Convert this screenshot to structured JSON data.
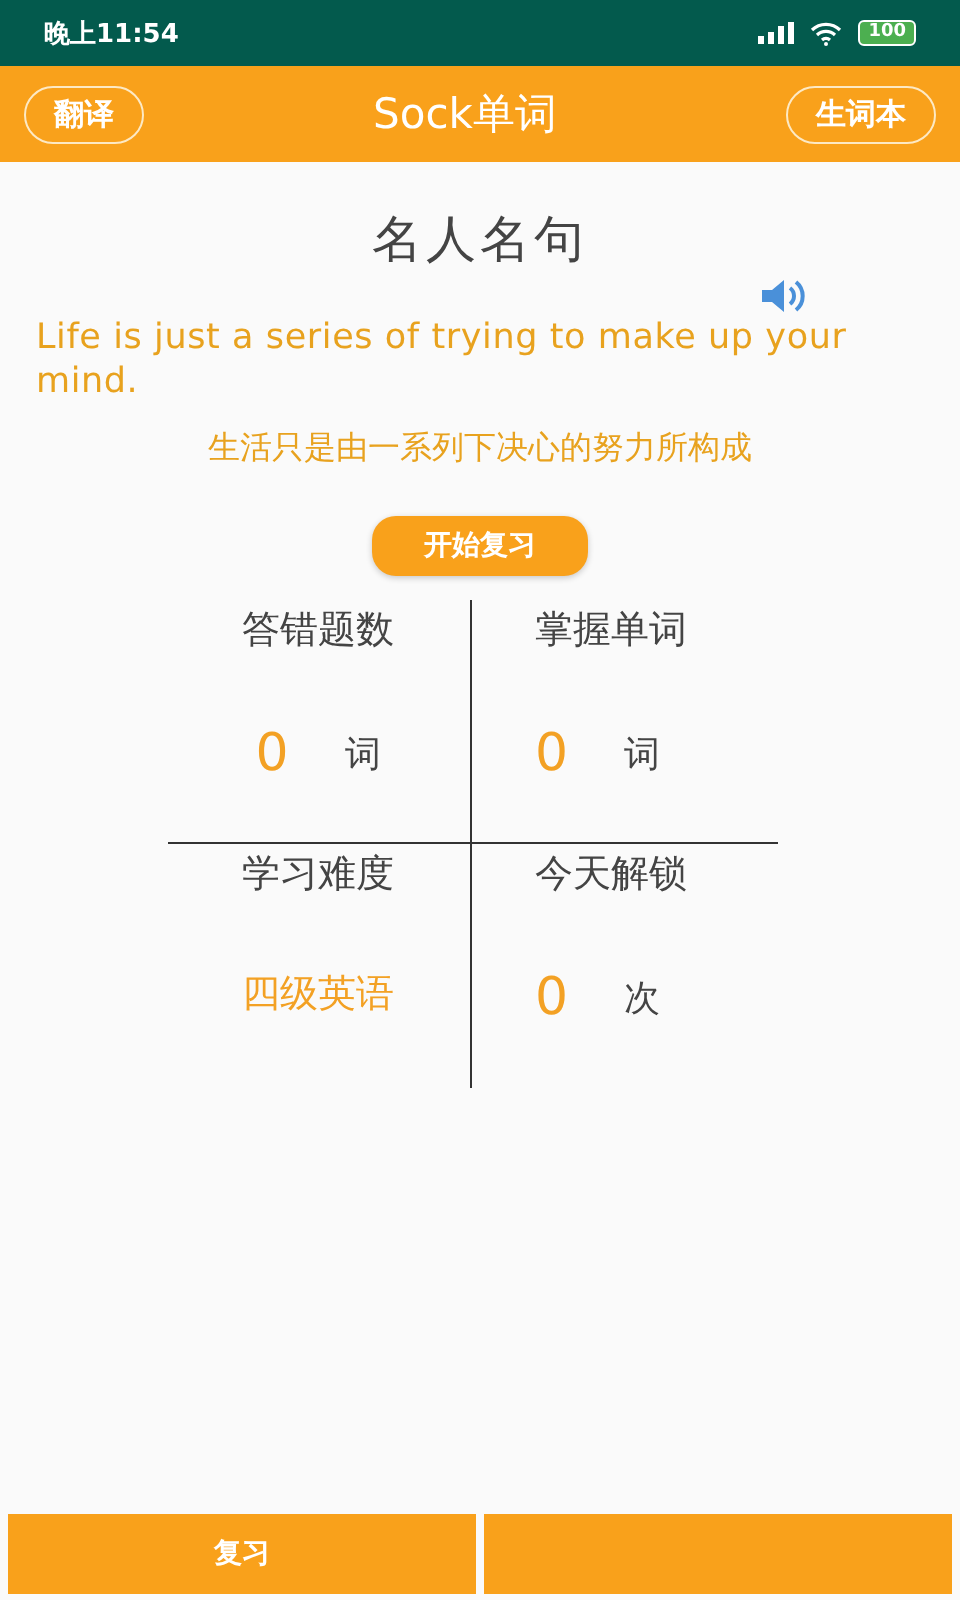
{
  "status_bar": {
    "time": "晚上11:54",
    "battery": "100"
  },
  "header": {
    "left_button": "翻译",
    "title": "Sock单词",
    "right_button": "生词本"
  },
  "quote": {
    "heading": "名人名句",
    "english": "Life is just a series of trying to make up your mind.",
    "chinese": "生活只是由一系列下决心的努力所构成"
  },
  "start_button": "开始复习",
  "stats": [
    {
      "label": "答错题数",
      "value": "0",
      "unit": "词"
    },
    {
      "label": "掌握单词",
      "value": "0",
      "unit": "词"
    },
    {
      "label": "学习难度",
      "value": "四级英语"
    },
    {
      "label": "今天解锁",
      "value": "0",
      "unit": "次"
    }
  ],
  "bottom_tabs": [
    "复习"
  ]
}
